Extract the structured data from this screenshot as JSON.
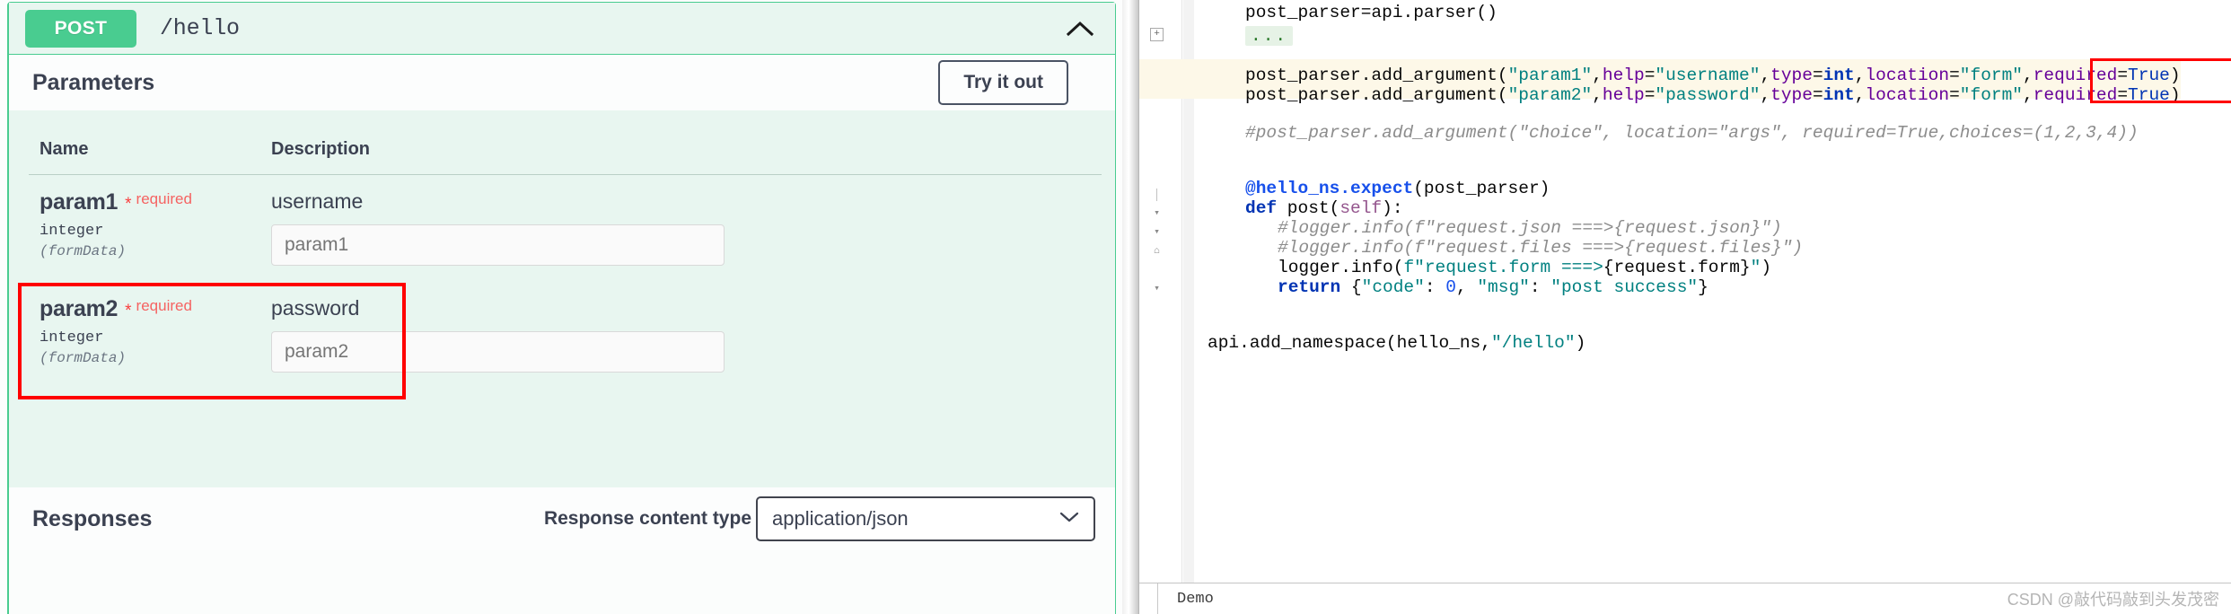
{
  "swagger": {
    "method": "POST",
    "path": "/hello",
    "collapse_icon": "chevron-up-icon",
    "parameters_title": "Parameters",
    "try_it_out_label": "Try it out",
    "table": {
      "headers": {
        "name": "Name",
        "description": "Description"
      },
      "rows": [
        {
          "name": "param1",
          "required_star": "*",
          "required_label": "required",
          "type": "integer",
          "in": "(formData)",
          "description": "username",
          "input_placeholder": "param1",
          "input_value": ""
        },
        {
          "name": "param2",
          "required_star": "*",
          "required_label": "required",
          "type": "integer",
          "in": "(formData)",
          "description": "password",
          "input_placeholder": "param2",
          "input_value": ""
        }
      ]
    },
    "responses_title": "Responses",
    "response_content_type_label": "Response content type",
    "response_content_type_value": "application/json",
    "response_content_type_options": [
      "application/json"
    ]
  },
  "editor": {
    "status_left": "Demo",
    "watermark": "CSDN @敲代码敲到头发茂密",
    "lines": [
      {
        "indent": 4,
        "text": "post_parser=api.parser()"
      },
      {
        "indent": 8,
        "text": "..."
      },
      {
        "indent": 4,
        "text": "post_parser.add_argument(\"param1\",help=\"username\",type=int,location=\"form\",required=True)"
      },
      {
        "indent": 4,
        "text": "post_parser.add_argument(\"param2\",help=\"password\",type=int,location=\"form\",required=True)"
      },
      {
        "indent": 4,
        "text": "#post_parser.add_argument(\"choice\", location=\"args\", required=True,choices=(1,2,3,4))"
      },
      {
        "indent": 4,
        "text": "@hello_ns.expect(post_parser)"
      },
      {
        "indent": 4,
        "text": "def post(self):"
      },
      {
        "indent": 8,
        "text": "#logger.info(f\"request.json ===>{request.json}\")"
      },
      {
        "indent": 8,
        "text": "#logger.info(f\"request.files ===>{request.files}\")"
      },
      {
        "indent": 8,
        "text": "logger.info(f\"request.form ===>{request.form}\")"
      },
      {
        "indent": 8,
        "text": "return {\"code\": 0, \"msg\": \"post success\"}"
      },
      {
        "indent": 0,
        "text": "api.add_namespace(hello_ns,\"/hello\")"
      }
    ]
  },
  "colors": {
    "method_green": "#49cc90",
    "panel_green_bg": "#e8f6f0",
    "required_red": "#f93e3e",
    "annotation_red": "#ff0000",
    "highlight_band": "#fdf8e8",
    "string_green": "#067d17",
    "keyword_blue": "#0033b3",
    "kwarg_purple": "#660099",
    "comment_gray": "#8c8c8c"
  }
}
